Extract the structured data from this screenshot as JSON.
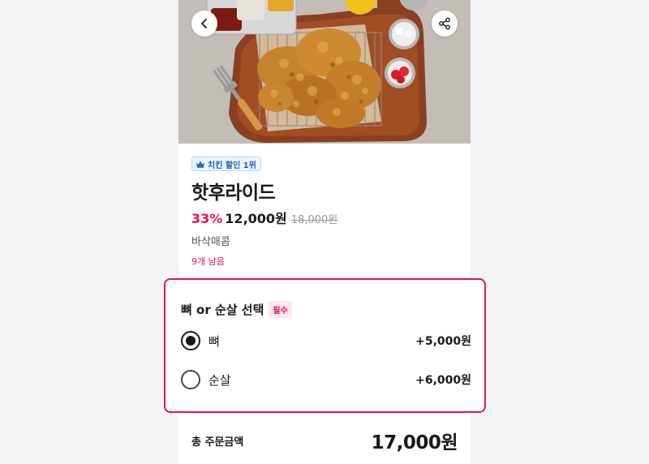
{
  "product": {
    "badge": "치킨 할인 1위",
    "title": "핫후라이드",
    "discount": "33%",
    "price": "12,000원",
    "original_price": "18,000원",
    "description": "바삭매콤",
    "stock": "9개 남음"
  },
  "option_group": {
    "title": "뼈 or 순살 선택",
    "required_label": "필수",
    "options": [
      {
        "label": "뼈",
        "price": "+5,000원",
        "selected": true
      },
      {
        "label": "순살",
        "price": "+6,000원",
        "selected": false
      }
    ]
  },
  "total": {
    "label": "총 주문금액",
    "value": "17,000원"
  },
  "icons": {
    "back": "chevron-left-icon",
    "share": "share-icon",
    "badge": "crown-icon"
  },
  "colors": {
    "accent": "#e5124f",
    "badge_blue": "#1f5fbf"
  }
}
